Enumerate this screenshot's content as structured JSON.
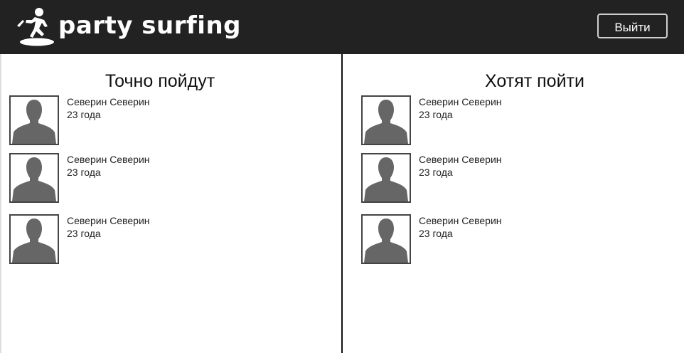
{
  "header": {
    "logo_text": "party surfing",
    "logout_label": "Выйти"
  },
  "columns": [
    {
      "title": "Точно пойдут",
      "people": [
        {
          "name": "Северин Северин",
          "age": "23 года"
        },
        {
          "name": "Северин Северин",
          "age": "23 года"
        },
        {
          "name": "Северин Северин",
          "age": "23 года"
        }
      ]
    },
    {
      "title": "Хотят пойти",
      "people": [
        {
          "name": "Северин Северин",
          "age": "23 года"
        },
        {
          "name": "Северин Северин",
          "age": "23 года"
        },
        {
          "name": "Северин Северин",
          "age": "23 года"
        }
      ]
    }
  ],
  "colors": {
    "header_bg": "#222222",
    "avatar_fill": "#666666",
    "divider": "#111111"
  },
  "icons": {
    "logo": "surfer-logo-icon",
    "avatar": "user-silhouette-icon"
  }
}
